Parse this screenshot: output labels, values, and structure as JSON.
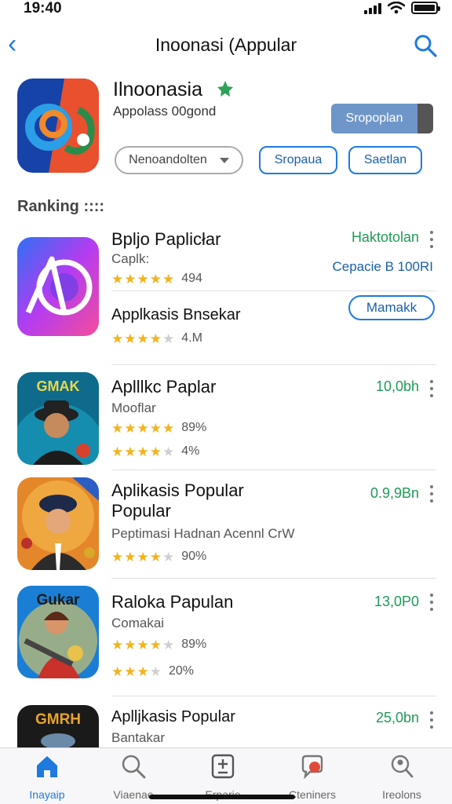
{
  "status_bar": {
    "time": "19:40"
  },
  "nav": {
    "title": "Inoonasi  (Appular"
  },
  "featured": {
    "name": "Ilnoonasia",
    "subtitle": "Appolass 00gond",
    "primary_button": "Sropoplan",
    "dropdown_label": "Nenoandolten",
    "pill_1": "Sropaua",
    "pill_2": "Saetlan"
  },
  "section": {
    "title": "Ranking ::::"
  },
  "list": [
    {
      "title": "Bpljo Paplicłar",
      "subtitle": "Caplk:",
      "rating_value": "494",
      "stars_filled": 5,
      "price": "Haktotolan",
      "link": "Cepacie B 100RI",
      "second_title": "Applkasis Bnsekar",
      "second_rating_value": "4.M",
      "second_stars_filled": 4,
      "outline_button": "Mamakk"
    },
    {
      "title": "Aplllkc Paplar",
      "subtitle": "Mooflar",
      "rating_value": "89%",
      "stars_filled": 4.5,
      "second_rating_value": "4%",
      "second_stars_filled": 4,
      "price": "10,0bh"
    },
    {
      "title": "Aplikasis Popular",
      "title_line2": "Popular",
      "subtitle": "Peptimasi Hadnan Acennl CrW",
      "rating_value": "90%",
      "stars_filled": 4,
      "price": "0.9,9Bn"
    },
    {
      "title": "Raloka Papulan",
      "subtitle": "Comakai",
      "rating_value": "89%",
      "stars_filled": 4,
      "second_rating_value": "20%",
      "second_stars_filled": 3.5,
      "price": "13,0P0"
    },
    {
      "title": "Aplljkasis Popular",
      "subtitle": "Bantakar",
      "price": "25,0bn"
    }
  ],
  "tabs": [
    {
      "label": "Inayaip",
      "icon": "home-icon"
    },
    {
      "label": "Viaenae",
      "icon": "search-icon"
    },
    {
      "label": "Erparie",
      "icon": "calculator-icon"
    },
    {
      "label": "Cteniners",
      "icon": "chat-icon"
    },
    {
      "label": "Ireolons",
      "icon": "profile-search-icon"
    }
  ],
  "colors": {
    "accent": "#1f7ae0",
    "price_green": "#1f9a57",
    "star": "#f2b31d"
  }
}
